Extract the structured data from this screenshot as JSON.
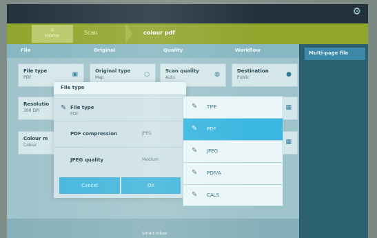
{
  "breadcrumb": {
    "home": "Home",
    "scan": "Scan",
    "profile": "colour pdf"
  },
  "tabs": [
    "File",
    "Original",
    "Quality",
    "Workflow"
  ],
  "sidebar": {
    "item": "Multi-page file"
  },
  "grid": {
    "file_type": {
      "label": "File type",
      "value": "PDF"
    },
    "original_type": {
      "label": "Original type",
      "value": "Map"
    },
    "scan_quality": {
      "label": "Scan quality",
      "value": "Auto"
    },
    "destination": {
      "label": "Destination",
      "value": "Public"
    },
    "resolution": {
      "label": "Resolutio",
      "value": "300 DPI"
    },
    "colour_mode": {
      "label": "Colour m",
      "value": "Colour"
    }
  },
  "dialog": {
    "title": "File type",
    "file_type": {
      "label": "File type",
      "value": "PDF"
    },
    "pdf_compression": {
      "label": "PDF compression",
      "value": "JPEG"
    },
    "jpeg_quality": {
      "label": "JPEG quality",
      "value": "Medium"
    },
    "cancel": "Cancel",
    "ok": "OK"
  },
  "dropdown": {
    "options": [
      "TIFF",
      "PDF",
      "JPEG",
      "PDF/A",
      "CALS"
    ],
    "selected": "PDF"
  },
  "footer": {
    "text": "Smart Inbox"
  }
}
